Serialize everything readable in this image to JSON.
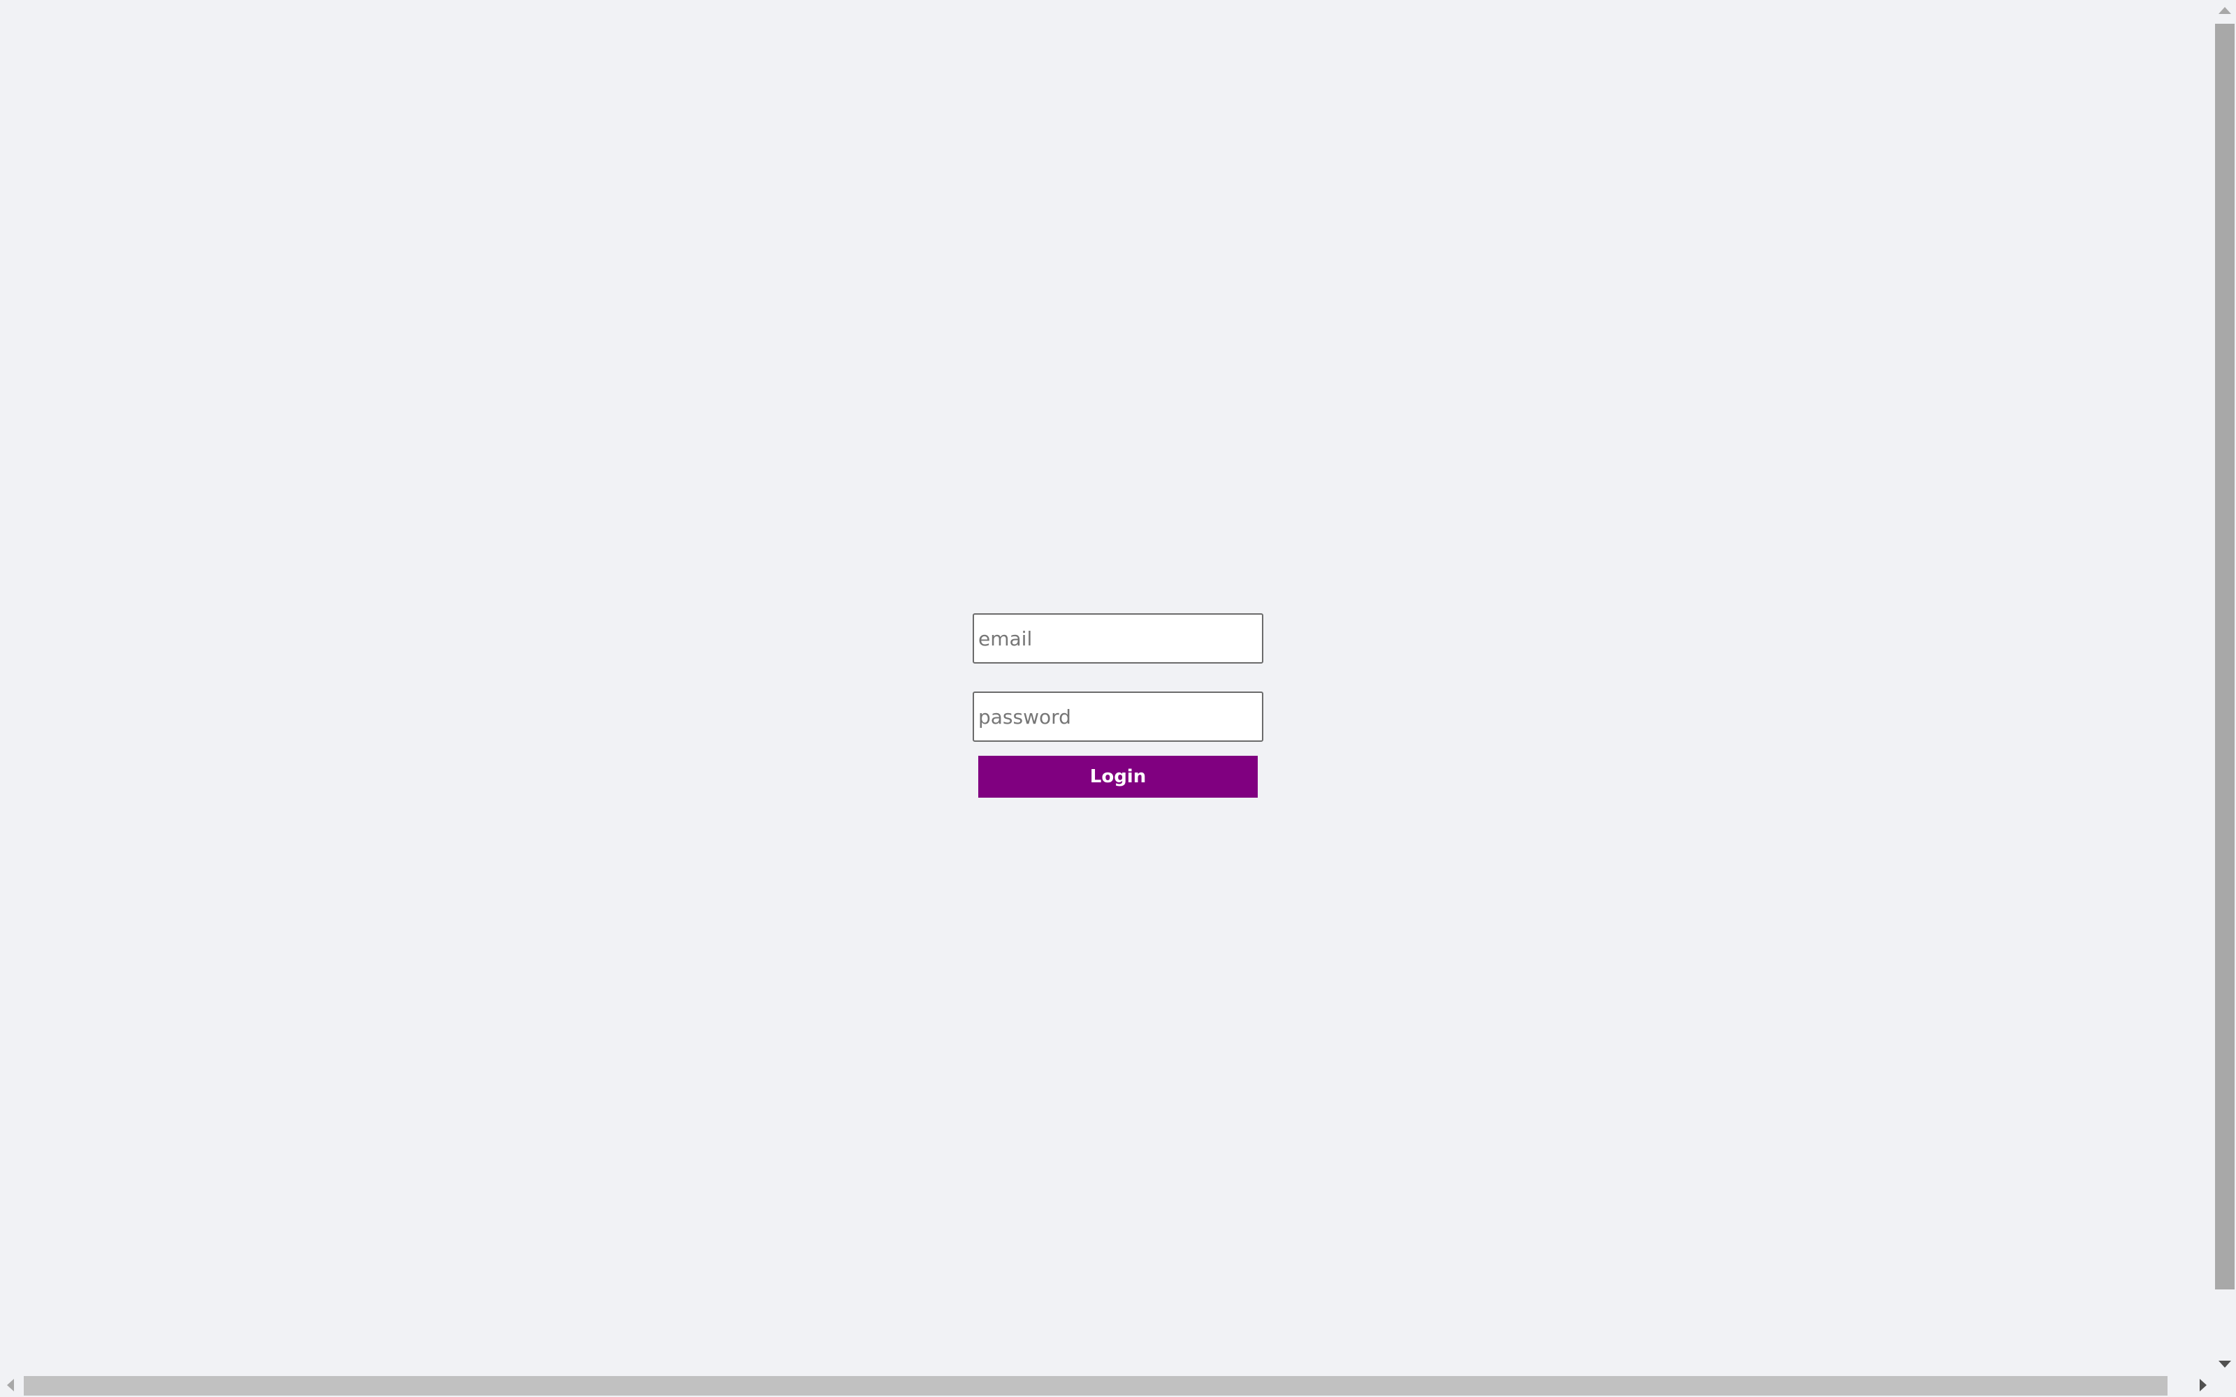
{
  "login_form": {
    "email_placeholder": "email",
    "email_value": "",
    "password_placeholder": "password",
    "password_value": "",
    "login_label": "Login"
  },
  "colors": {
    "page_background": "#f1f2f5",
    "login_button_background": "#800080",
    "login_button_text": "#ffffff"
  }
}
